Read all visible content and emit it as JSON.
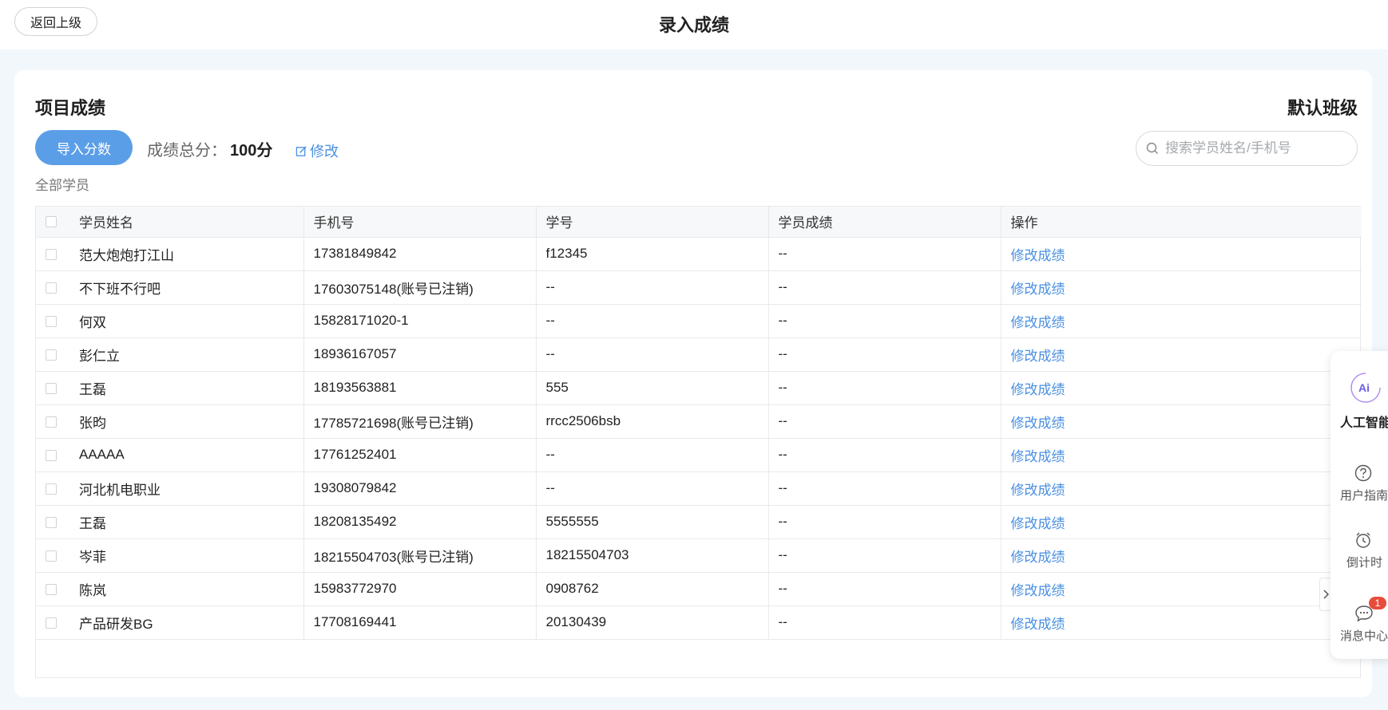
{
  "header": {
    "back_label": "返回上级",
    "title": "录入成绩"
  },
  "card": {
    "section_title": "项目成绩",
    "class_name": "默认班级",
    "import_label": "导入分数",
    "total_label": "成绩总分：",
    "total_value": "100分",
    "edit_label": "修改",
    "search_placeholder": "搜索学员姓名/手机号",
    "all_students_label": "全部学员"
  },
  "table": {
    "columns": [
      "学员姓名",
      "手机号",
      "学号",
      "学员成绩",
      "操作"
    ],
    "rows": [
      {
        "name": "范大炮炮打江山",
        "phone": "17381849842",
        "id": "f12345",
        "score": "--",
        "action": "修改成绩"
      },
      {
        "name": "不下班不行吧",
        "phone": "17603075148(账号已注销)",
        "id": "--",
        "score": "--",
        "action": "修改成绩"
      },
      {
        "name": "何双",
        "phone": "15828171020-1",
        "id": "--",
        "score": "--",
        "action": "修改成绩"
      },
      {
        "name": "彭仁立",
        "phone": "18936167057",
        "id": "--",
        "score": "--",
        "action": "修改成绩"
      },
      {
        "name": "王磊",
        "phone": "18193563881",
        "id": "555",
        "score": "--",
        "action": "修改成绩"
      },
      {
        "name": "张昀",
        "phone": "17785721698(账号已注销)",
        "id": "rrcc2506bsb",
        "score": "--",
        "action": "修改成绩"
      },
      {
        "name": "AAAAA",
        "phone": "17761252401",
        "id": "--",
        "score": "--",
        "action": "修改成绩"
      },
      {
        "name": "河北机电职业",
        "phone": "19308079842",
        "id": "--",
        "score": "--",
        "action": "修改成绩"
      },
      {
        "name": "王磊",
        "phone": "18208135492",
        "id": "5555555",
        "score": "--",
        "action": "修改成绩"
      },
      {
        "name": "岑菲",
        "phone": "18215504703(账号已注销)",
        "id": "18215504703",
        "score": "--",
        "action": "修改成绩"
      },
      {
        "name": "陈岚",
        "phone": "15983772970",
        "id": "0908762",
        "score": "--",
        "action": "修改成绩"
      },
      {
        "name": "产品研发BG",
        "phone": "17708169441",
        "id": "20130439",
        "score": "--",
        "action": "修改成绩"
      }
    ]
  },
  "side_panel": {
    "ai_icon_text": "Ai",
    "ai_label": "人工智能",
    "guide_label": "用户指南",
    "timer_label": "倒计时",
    "messages_label": "消息中心",
    "messages_badge": "1"
  },
  "colors": {
    "accent": "#5b9ee8",
    "link": "#4a90e2",
    "badge": "#e74c3c",
    "page_bg": "#f2f7fc"
  }
}
